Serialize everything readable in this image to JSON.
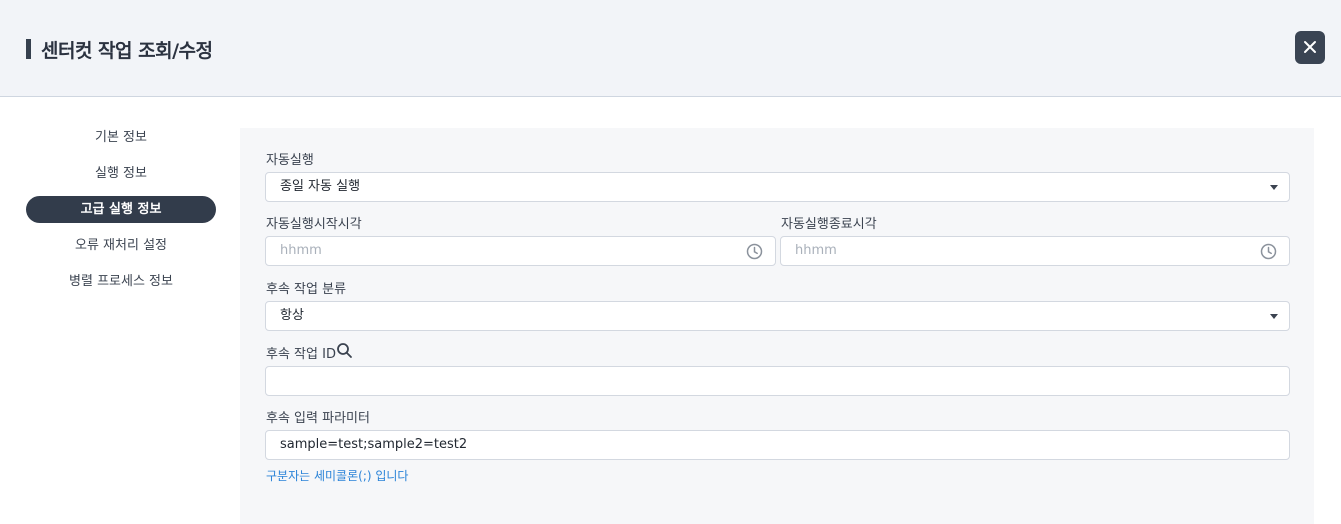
{
  "header": {
    "title": "센터컷 작업 조회/수정"
  },
  "sidebar": {
    "items": [
      {
        "label": "기본 정보",
        "active": false
      },
      {
        "label": "실행 정보",
        "active": false
      },
      {
        "label": "고급 실행 정보",
        "active": true
      },
      {
        "label": "오류 재처리 설정",
        "active": false
      },
      {
        "label": "병렬 프로세스 정보",
        "active": false
      }
    ]
  },
  "form": {
    "auto_run": {
      "label": "자동실행",
      "value": "종일 자동 실행"
    },
    "start_time": {
      "label": "자동실행시작시각",
      "placeholder": "hhmm"
    },
    "end_time": {
      "label": "자동실행종료시각",
      "placeholder": "hhmm"
    },
    "followup_type": {
      "label": "후속 작업 분류",
      "value": "항상"
    },
    "followup_id": {
      "label": "후속 작업 ID",
      "value": ""
    },
    "followup_params": {
      "label": "후속 입력 파라미터",
      "value": "sample=test;sample2=test2",
      "hint": "구분자는 세미콜론(;) 입니다"
    }
  },
  "colors": {
    "accent": "#323c4b",
    "hint": "#2a83d8"
  }
}
